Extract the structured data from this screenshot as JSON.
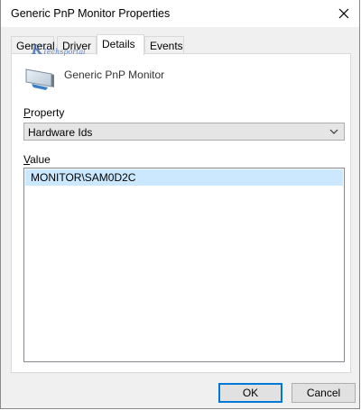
{
  "window": {
    "title": "Generic PnP Monitor Properties"
  },
  "tabs": [
    {
      "label": "General"
    },
    {
      "label": "Driver"
    },
    {
      "label": "Details"
    },
    {
      "label": "Events"
    }
  ],
  "watermark": {
    "text": "Techsportal"
  },
  "device": {
    "name": "Generic PnP Monitor",
    "icon": "monitor-icon"
  },
  "property": {
    "label_mnemonic": "P",
    "label_rest": "roperty",
    "selected": "Hardware Ids"
  },
  "value": {
    "label_mnemonic": "V",
    "label_rest": "alue",
    "items": [
      "MONITOR\\SAM0D2C"
    ]
  },
  "buttons": {
    "ok": "OK",
    "cancel": "Cancel"
  },
  "colors": {
    "selection": "#cce8ff",
    "default_button_border": "#0078d7"
  }
}
